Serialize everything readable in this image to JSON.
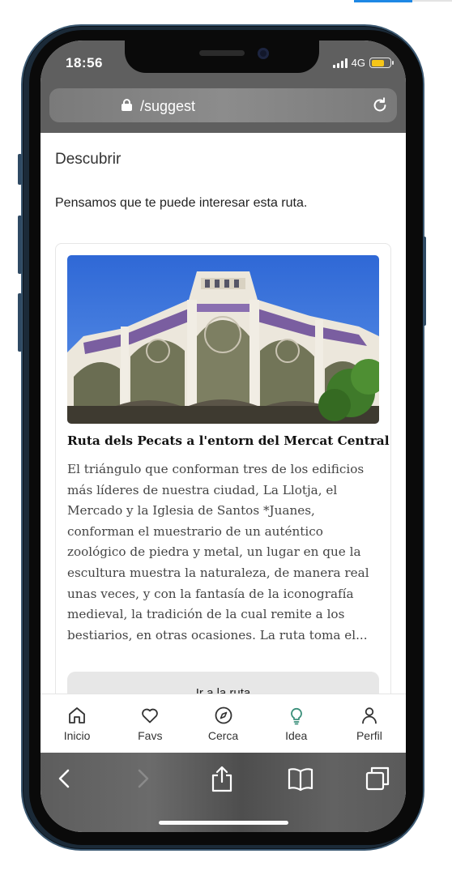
{
  "status_bar": {
    "time": "18:56",
    "network": "4G",
    "battery_level": 0.7
  },
  "browser": {
    "url": "/suggest"
  },
  "page": {
    "title": "Descubrir",
    "lead": "Pensamos que te puede interesar esta ruta."
  },
  "route_card": {
    "image_alt": "Mercat Central",
    "title": "Ruta dels Pecats a l'entorn del Mercat Central",
    "description": "El triángulo que conforman tres de los edificios más líderes de nuestra ciudad, La Llotja, el Mercado y la Iglesia de Santos *Juanes, conforman el muestrario de un auténtico zoológico de piedra y metal, un lugar en que la escultura muestra la naturaleza, de manera real unas veces, y con la fantasía de la iconografía medieval, la tradición de la cual remite a los bestiarios, en otras ocasiones. La ruta toma el...",
    "cta_label": "Ir a la ruta"
  },
  "tabbar": {
    "items": [
      {
        "label": "Inicio",
        "icon": "home-icon"
      },
      {
        "label": "Favs",
        "icon": "heart-icon"
      },
      {
        "label": "Cerca",
        "icon": "compass-icon"
      },
      {
        "label": "Idea",
        "icon": "lightbulb-icon",
        "active": true
      },
      {
        "label": "Perfil",
        "icon": "user-icon"
      }
    ],
    "active_color": "#3a8f7a"
  }
}
